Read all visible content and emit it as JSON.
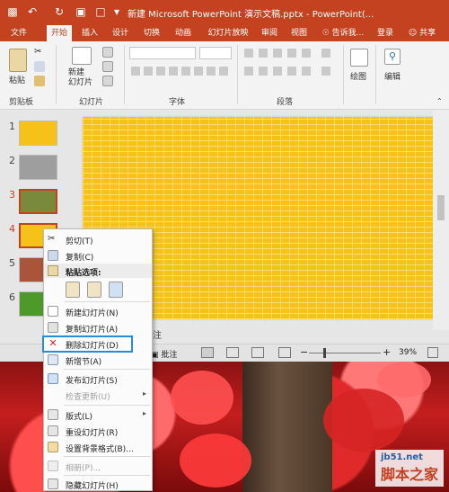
{
  "titlebar": {
    "title": "新建 Microsoft PowerPoint 演示文稿.pptx - PowerPoint(..."
  },
  "tabs": [
    "文件",
    "开始",
    "插入",
    "设计",
    "切换",
    "动画",
    "幻灯片放映",
    "审阅",
    "视图"
  ],
  "tab_active_index": 1,
  "tell_me": "告诉我...",
  "login": "登录",
  "share": "共享",
  "ribbon": {
    "paste": "粘贴",
    "new_slide": "新建\n幻灯片",
    "clipboard": "剪贴板",
    "slides": "幻灯片",
    "font": "字体",
    "paragraph": "段落",
    "draw": "绘图",
    "edit": "编辑"
  },
  "thumbnails": [
    {
      "num": "1",
      "color": "#f6c21a"
    },
    {
      "num": "2",
      "color": "#9e9e9e"
    },
    {
      "num": "3",
      "color": "#7a8a3c"
    },
    {
      "num": "4",
      "color": "#f6c21a"
    },
    {
      "num": "5",
      "color": "#a8553a"
    },
    {
      "num": "6",
      "color": "#4d9a2a"
    }
  ],
  "notes_label": "注",
  "status": {
    "comments": "批注",
    "zoom": "39%"
  },
  "context_menu": {
    "cut": "剪切(T)",
    "copy": "复制(C)",
    "paste_options": "粘贴选项:",
    "new_slide": "新建幻灯片(N)",
    "duplicate_slide": "复制幻灯片(A)",
    "delete_slide": "删除幻灯片(D)",
    "add_section": "新增节(A)",
    "publish_slides": "发布幻灯片(S)",
    "check_updates": "检查更新(U)",
    "layout": "版式(L)",
    "reset_slide": "重设幻灯片(R)",
    "format_background": "设置背景格式(B)...",
    "photo_album": "相册(P)...",
    "hide_slide": "隐藏幻灯片(H)"
  },
  "watermark": {
    "site": "jb51.net",
    "name": "脚本之家"
  }
}
